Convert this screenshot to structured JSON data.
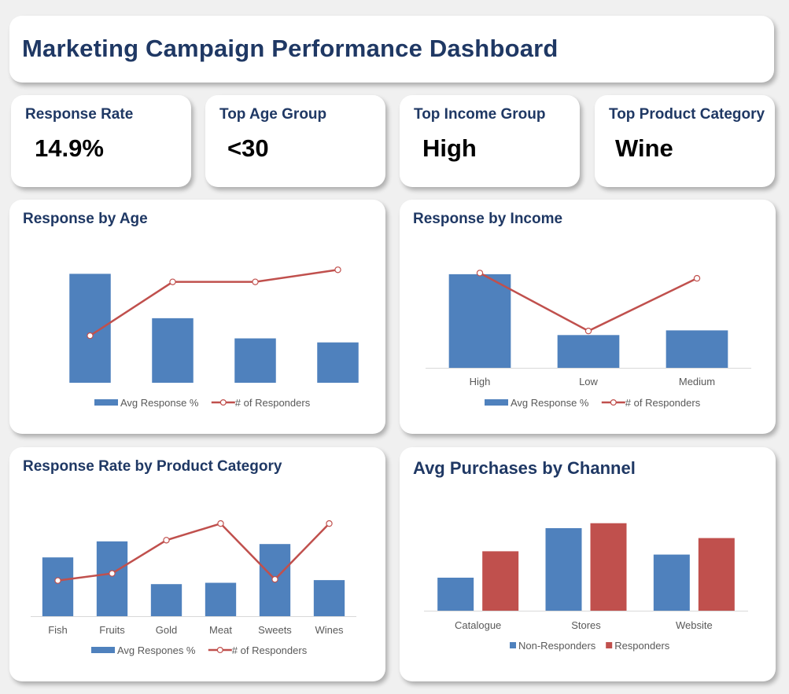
{
  "page": {
    "title": "Marketing Campaign Performance Dashboard"
  },
  "kpis": [
    {
      "label": "Response Rate",
      "value": "14.9%"
    },
    {
      "label": "Top Age Group",
      "value": "<30"
    },
    {
      "label": "Top Income Group",
      "value": "High"
    },
    {
      "label": "Top Product Category",
      "value": "Wine"
    }
  ],
  "colors": {
    "bar_blue": "#4f81bd",
    "line_red": "#c0504d",
    "bar_red": "#c0504d",
    "title_navy": "#1f3864"
  },
  "chart_data": [
    {
      "id": "age",
      "type": "bar+line",
      "title": "Response by Age",
      "categories": [
        "",
        "",
        "",
        ""
      ],
      "series": [
        {
          "name": "Avg Response %",
          "kind": "bar",
          "values": [
            0.27,
            0.16,
            0.11,
            0.1
          ]
        },
        {
          "name": "# of Responders",
          "kind": "line",
          "values": [
            70,
            150,
            150,
            168
          ]
        }
      ],
      "bar_ylim": [
        0,
        0.3
      ],
      "line_ylim": [
        0,
        180
      ],
      "show_x_labels": false,
      "legend": "bottom",
      "grid": false
    },
    {
      "id": "income",
      "type": "bar+line",
      "title": "Response by Income",
      "categories": [
        "High",
        "Low",
        "Medium"
      ],
      "series": [
        {
          "name": "Avg Response %",
          "kind": "bar",
          "values": [
            0.4,
            0.14,
            0.16
          ]
        },
        {
          "name": "# of Responders",
          "kind": "line",
          "values": [
            360,
            140,
            340
          ]
        }
      ],
      "bar_ylim": [
        0,
        0.45
      ],
      "line_ylim": [
        0,
        400
      ],
      "show_x_labels": true,
      "legend": "bottom",
      "grid": false
    },
    {
      "id": "product",
      "type": "bar+line",
      "title": "Response Rate by Product Category",
      "categories": [
        "Fish",
        "Fruits",
        "Gold",
        "Meat",
        "Sweets",
        "Wines"
      ],
      "series": [
        {
          "name": "Avg Respones %",
          "kind": "bar",
          "values": [
            0.22,
            0.28,
            0.12,
            0.125,
            0.27,
            0.135
          ]
        },
        {
          "name": "# of Responders",
          "kind": "line",
          "values": [
            150,
            180,
            320,
            390,
            155,
            390
          ]
        }
      ],
      "bar_ylim": [
        0,
        0.4
      ],
      "line_ylim": [
        0,
        450
      ],
      "show_x_labels": true,
      "legend": "bottom",
      "grid": false
    },
    {
      "id": "channel",
      "type": "bar",
      "title": "Avg Purchases by Channel",
      "categories": [
        "Catalogue",
        "Stores",
        "Website"
      ],
      "series": [
        {
          "name": "Non-Responders",
          "values": [
            2.0,
            5.0,
            3.4
          ]
        },
        {
          "name": "Responders",
          "values": [
            3.6,
            5.3,
            4.4
          ]
        }
      ],
      "ylim": [
        0,
        6
      ],
      "show_x_labels": true,
      "legend": "bottom",
      "grid": false
    }
  ]
}
